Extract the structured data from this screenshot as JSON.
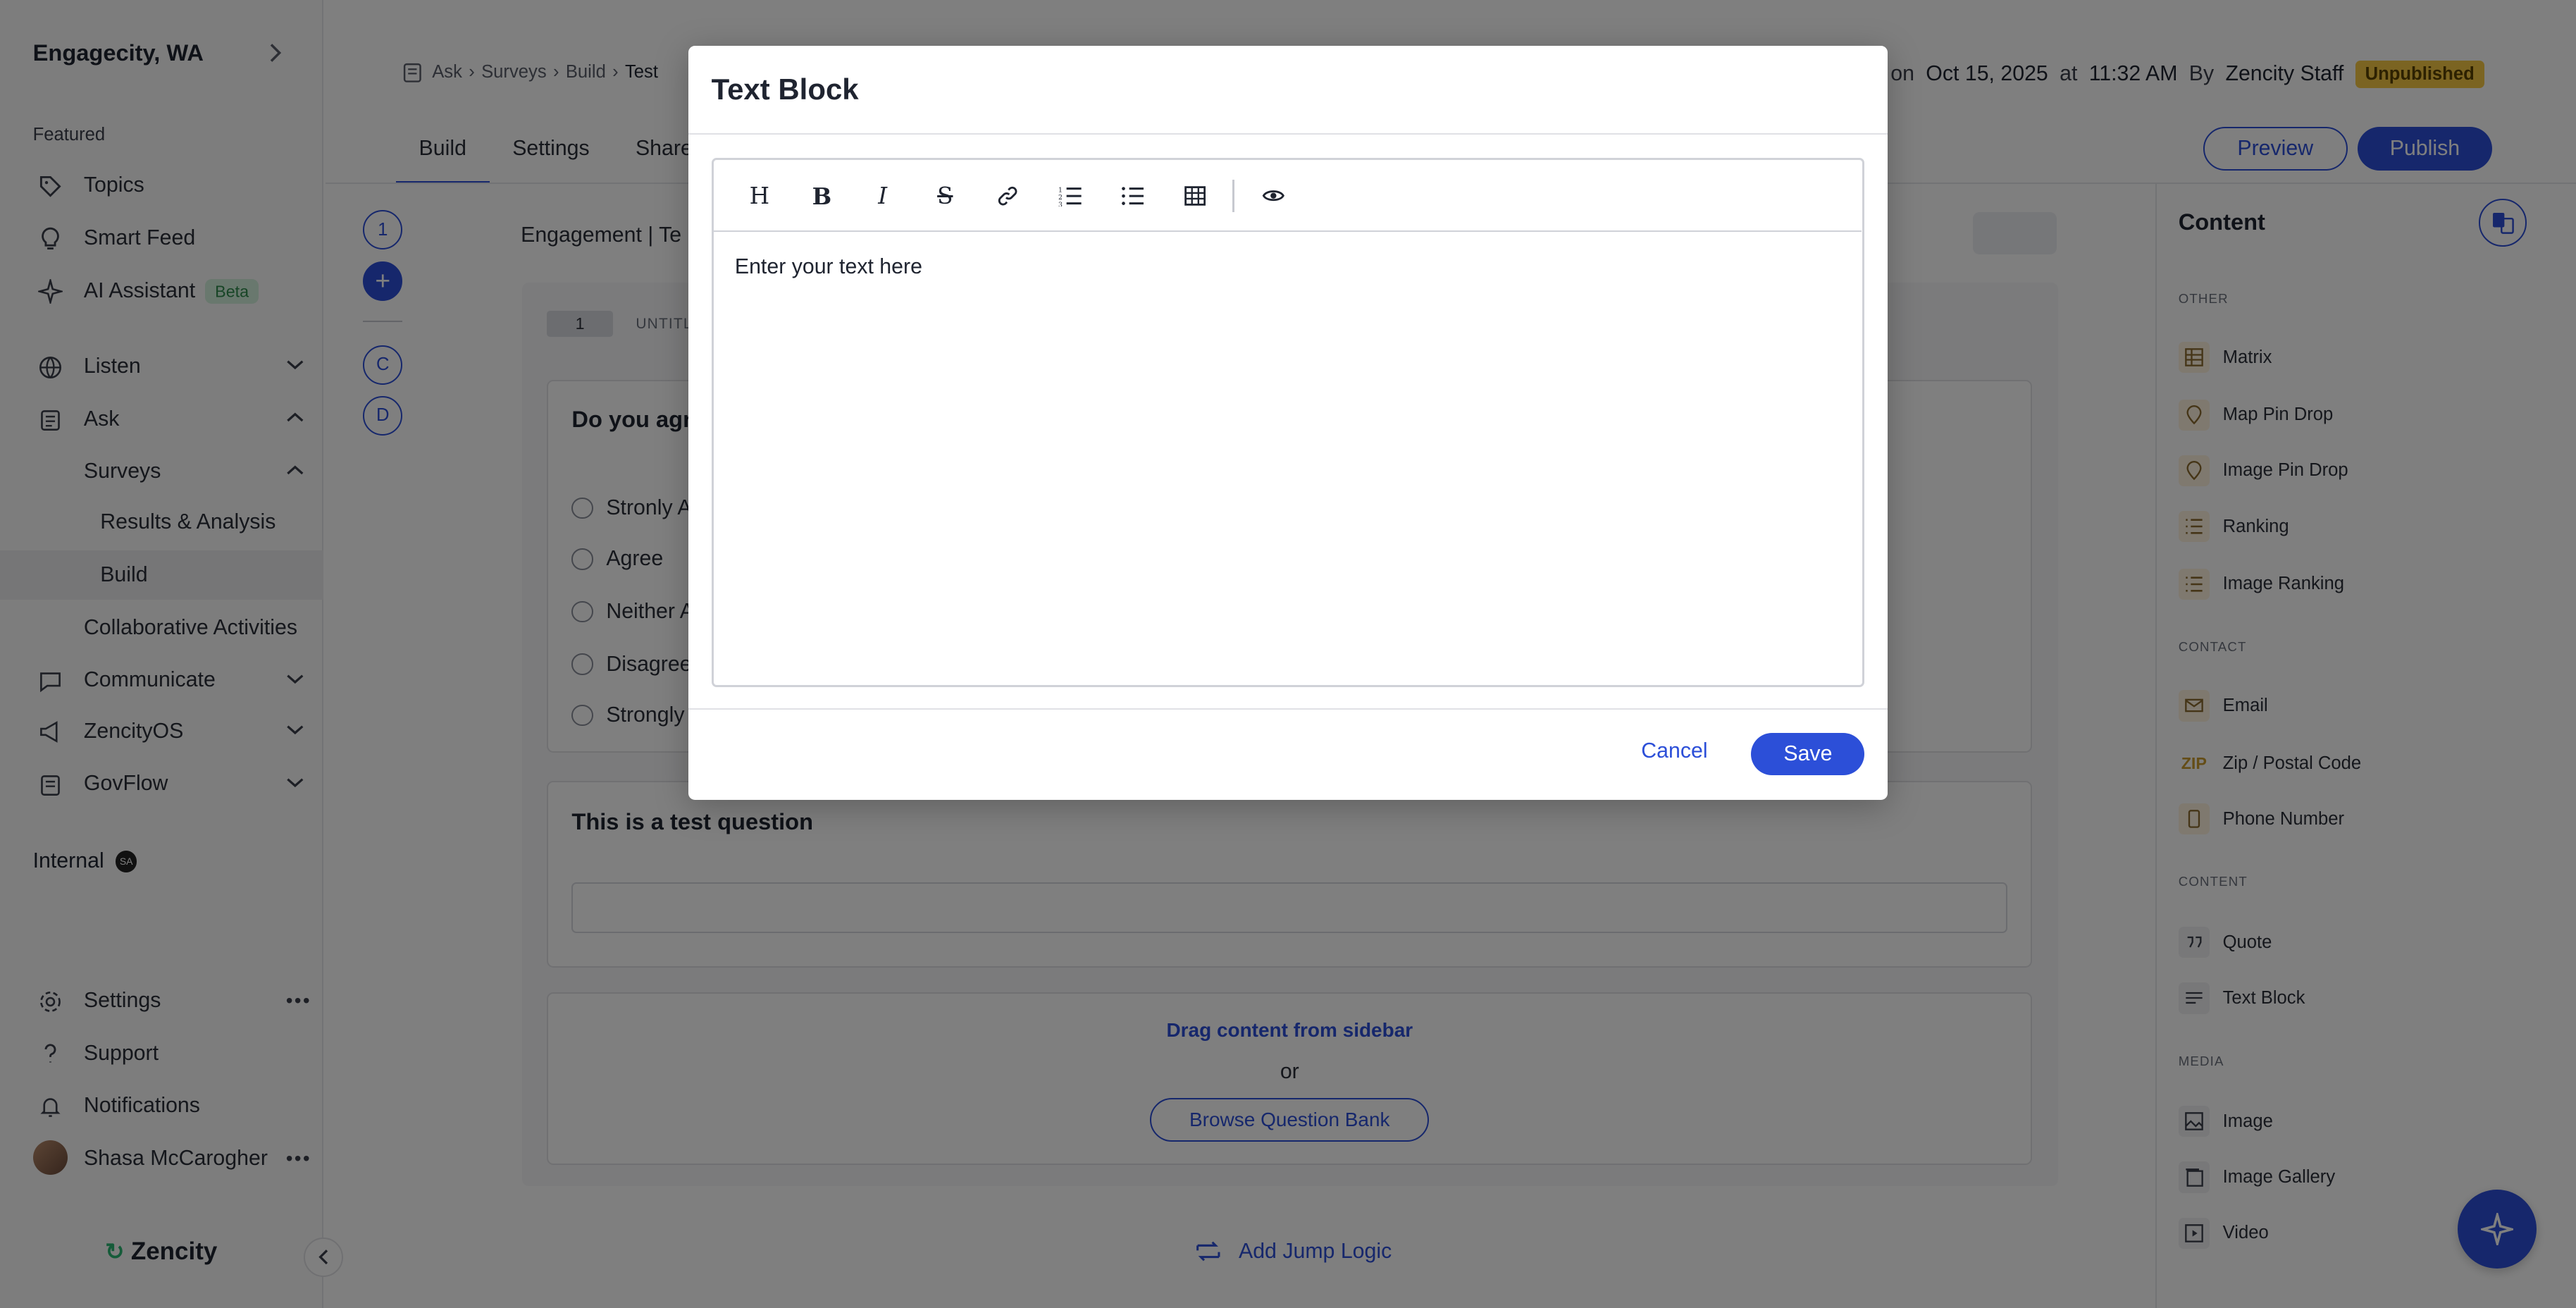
{
  "sidebar": {
    "org_name": "Engagecity, WA",
    "featured_label": "Featured",
    "items": [
      {
        "label": "Topics"
      },
      {
        "label": "Smart Feed"
      },
      {
        "label": "AI Assistant",
        "badge": "Beta"
      },
      {
        "label": "Listen"
      },
      {
        "label": "Ask"
      },
      {
        "label": "Surveys"
      },
      {
        "label": "Results & Analysis"
      },
      {
        "label": "Build"
      },
      {
        "label": "Collaborative Activities"
      },
      {
        "label": "Communicate"
      },
      {
        "label": "ZencityOS"
      },
      {
        "label": "GovFlow"
      }
    ],
    "internal_label": "Internal",
    "internal_badge": "SA",
    "bottom": [
      {
        "label": "Settings"
      },
      {
        "label": "Support"
      },
      {
        "label": "Notifications"
      },
      {
        "label": "Shasa McCarogher"
      }
    ],
    "logo_text": "Zencity"
  },
  "breadcrumb": {
    "items": [
      "Ask",
      "Surveys",
      "Build",
      "Test"
    ]
  },
  "meta": {
    "prefix": "d on",
    "date": "Oct 15, 2025",
    "at": "at",
    "time": "11:32 AM",
    "by": "By",
    "author": "Zencity Staff",
    "status": "Unpublished"
  },
  "tabs": [
    "Build",
    "Settings",
    "Share"
  ],
  "actions": {
    "preview": "Preview",
    "publish": "Publish"
  },
  "rail": {
    "items": [
      "1",
      "+",
      "C",
      "D"
    ]
  },
  "canvas": {
    "engagement_title": "Engagement  |  Te",
    "page_number": "1",
    "page_name": "UNTITL",
    "question1": "Do you agr",
    "options": [
      "Stronly A",
      "Agree",
      "Neither A",
      "Disagree",
      "Strongly"
    ],
    "question2": "This is a test question",
    "drag_hint": "Drag content from sidebar",
    "or_text": "or",
    "browse_label": "Browse Question Bank",
    "jump_logic": "Add Jump Logic"
  },
  "right_panel": {
    "title": "Content",
    "sections": [
      {
        "label": "OTHER",
        "items": [
          "Matrix",
          "Map Pin Drop",
          "Image Pin Drop",
          "Ranking",
          "Image Ranking"
        ]
      },
      {
        "label": "CONTACT",
        "items": [
          "Email",
          "Zip / Postal Code",
          "Phone Number"
        ]
      },
      {
        "label": "CONTENT",
        "items": [
          "Quote",
          "Text Block"
        ]
      },
      {
        "label": "MEDIA",
        "items": [
          "Image",
          "Image Gallery",
          "Video"
        ]
      }
    ],
    "zip_icon_text": "ZIP"
  },
  "modal": {
    "title": "Text Block",
    "toolbar": [
      "heading-icon",
      "bold-icon",
      "italic-icon",
      "strikethrough-icon",
      "link-icon",
      "ordered-list-icon",
      "bullet-list-icon",
      "table-icon",
      "preview-eye-icon"
    ],
    "heading_glyph": "H",
    "bold_glyph": "B",
    "italic_glyph": "I",
    "strike_glyph": "S",
    "placeholder_text": "Enter your text here",
    "cancel_label": "Cancel",
    "save_label": "Save"
  },
  "colors": {
    "accent": "#2c4fd8",
    "status_badge": "#f6c945",
    "overlay": "rgba(0,0,0,0.5)"
  }
}
